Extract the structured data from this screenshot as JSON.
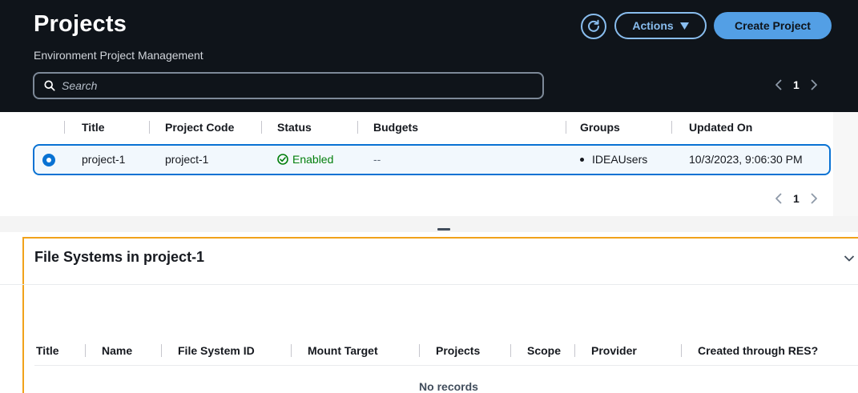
{
  "header": {
    "title": "Projects",
    "subtitle": "Environment Project Management",
    "actions_label": "Actions",
    "create_label": "Create Project"
  },
  "search": {
    "placeholder": "Search",
    "value": ""
  },
  "pagination": {
    "current_page": "1"
  },
  "projects_table": {
    "columns": [
      "Title",
      "Project Code",
      "Status",
      "Budgets",
      "Groups",
      "Updated On"
    ],
    "rows": [
      {
        "title": "project-1",
        "project_code": "project-1",
        "status": "Enabled",
        "budgets": "--",
        "groups": "IDEAUsers",
        "updated_on": "10/3/2023, 9:06:30 PM",
        "selected": true
      }
    ]
  },
  "file_systems_panel": {
    "title": "File Systems in project-1",
    "columns": [
      "Title",
      "Name",
      "File System ID",
      "Mount Target",
      "Projects",
      "Scope",
      "Provider",
      "Created through RES?"
    ],
    "empty_text": "No records"
  },
  "colors": {
    "header_bg": "#0f141a",
    "accent_blue": "#539fe5",
    "selected_border": "#0972d3",
    "status_green": "#037f0c",
    "panel_border": "#f1a21a"
  },
  "icons": {
    "search": "search-icon",
    "refresh": "refresh-icon",
    "dropdown": "caret-down-icon",
    "prev": "chevron-left-icon",
    "next": "chevron-right-icon",
    "status": "check-circle-icon",
    "collapse": "chevron-down-icon"
  }
}
